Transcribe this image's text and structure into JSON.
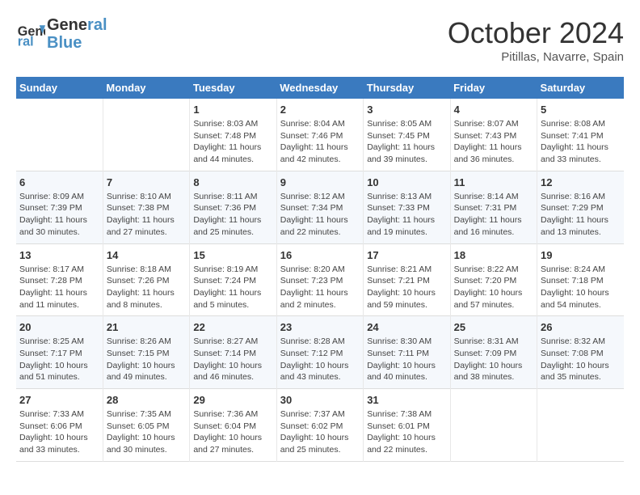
{
  "header": {
    "logo_line1": "General",
    "logo_line2": "Blue",
    "month": "October 2024",
    "location": "Pitillas, Navarre, Spain"
  },
  "columns": [
    "Sunday",
    "Monday",
    "Tuesday",
    "Wednesday",
    "Thursday",
    "Friday",
    "Saturday"
  ],
  "weeks": [
    [
      {
        "day": "",
        "info": ""
      },
      {
        "day": "",
        "info": ""
      },
      {
        "day": "1",
        "info": "Sunrise: 8:03 AM\nSunset: 7:48 PM\nDaylight: 11 hours and 44 minutes."
      },
      {
        "day": "2",
        "info": "Sunrise: 8:04 AM\nSunset: 7:46 PM\nDaylight: 11 hours and 42 minutes."
      },
      {
        "day": "3",
        "info": "Sunrise: 8:05 AM\nSunset: 7:45 PM\nDaylight: 11 hours and 39 minutes."
      },
      {
        "day": "4",
        "info": "Sunrise: 8:07 AM\nSunset: 7:43 PM\nDaylight: 11 hours and 36 minutes."
      },
      {
        "day": "5",
        "info": "Sunrise: 8:08 AM\nSunset: 7:41 PM\nDaylight: 11 hours and 33 minutes."
      }
    ],
    [
      {
        "day": "6",
        "info": "Sunrise: 8:09 AM\nSunset: 7:39 PM\nDaylight: 11 hours and 30 minutes."
      },
      {
        "day": "7",
        "info": "Sunrise: 8:10 AM\nSunset: 7:38 PM\nDaylight: 11 hours and 27 minutes."
      },
      {
        "day": "8",
        "info": "Sunrise: 8:11 AM\nSunset: 7:36 PM\nDaylight: 11 hours and 25 minutes."
      },
      {
        "day": "9",
        "info": "Sunrise: 8:12 AM\nSunset: 7:34 PM\nDaylight: 11 hours and 22 minutes."
      },
      {
        "day": "10",
        "info": "Sunrise: 8:13 AM\nSunset: 7:33 PM\nDaylight: 11 hours and 19 minutes."
      },
      {
        "day": "11",
        "info": "Sunrise: 8:14 AM\nSunset: 7:31 PM\nDaylight: 11 hours and 16 minutes."
      },
      {
        "day": "12",
        "info": "Sunrise: 8:16 AM\nSunset: 7:29 PM\nDaylight: 11 hours and 13 minutes."
      }
    ],
    [
      {
        "day": "13",
        "info": "Sunrise: 8:17 AM\nSunset: 7:28 PM\nDaylight: 11 hours and 11 minutes."
      },
      {
        "day": "14",
        "info": "Sunrise: 8:18 AM\nSunset: 7:26 PM\nDaylight: 11 hours and 8 minutes."
      },
      {
        "day": "15",
        "info": "Sunrise: 8:19 AM\nSunset: 7:24 PM\nDaylight: 11 hours and 5 minutes."
      },
      {
        "day": "16",
        "info": "Sunrise: 8:20 AM\nSunset: 7:23 PM\nDaylight: 11 hours and 2 minutes."
      },
      {
        "day": "17",
        "info": "Sunrise: 8:21 AM\nSunset: 7:21 PM\nDaylight: 10 hours and 59 minutes."
      },
      {
        "day": "18",
        "info": "Sunrise: 8:22 AM\nSunset: 7:20 PM\nDaylight: 10 hours and 57 minutes."
      },
      {
        "day": "19",
        "info": "Sunrise: 8:24 AM\nSunset: 7:18 PM\nDaylight: 10 hours and 54 minutes."
      }
    ],
    [
      {
        "day": "20",
        "info": "Sunrise: 8:25 AM\nSunset: 7:17 PM\nDaylight: 10 hours and 51 minutes."
      },
      {
        "day": "21",
        "info": "Sunrise: 8:26 AM\nSunset: 7:15 PM\nDaylight: 10 hours and 49 minutes."
      },
      {
        "day": "22",
        "info": "Sunrise: 8:27 AM\nSunset: 7:14 PM\nDaylight: 10 hours and 46 minutes."
      },
      {
        "day": "23",
        "info": "Sunrise: 8:28 AM\nSunset: 7:12 PM\nDaylight: 10 hours and 43 minutes."
      },
      {
        "day": "24",
        "info": "Sunrise: 8:30 AM\nSunset: 7:11 PM\nDaylight: 10 hours and 40 minutes."
      },
      {
        "day": "25",
        "info": "Sunrise: 8:31 AM\nSunset: 7:09 PM\nDaylight: 10 hours and 38 minutes."
      },
      {
        "day": "26",
        "info": "Sunrise: 8:32 AM\nSunset: 7:08 PM\nDaylight: 10 hours and 35 minutes."
      }
    ],
    [
      {
        "day": "27",
        "info": "Sunrise: 7:33 AM\nSunset: 6:06 PM\nDaylight: 10 hours and 33 minutes."
      },
      {
        "day": "28",
        "info": "Sunrise: 7:35 AM\nSunset: 6:05 PM\nDaylight: 10 hours and 30 minutes."
      },
      {
        "day": "29",
        "info": "Sunrise: 7:36 AM\nSunset: 6:04 PM\nDaylight: 10 hours and 27 minutes."
      },
      {
        "day": "30",
        "info": "Sunrise: 7:37 AM\nSunset: 6:02 PM\nDaylight: 10 hours and 25 minutes."
      },
      {
        "day": "31",
        "info": "Sunrise: 7:38 AM\nSunset: 6:01 PM\nDaylight: 10 hours and 22 minutes."
      },
      {
        "day": "",
        "info": ""
      },
      {
        "day": "",
        "info": ""
      }
    ]
  ]
}
